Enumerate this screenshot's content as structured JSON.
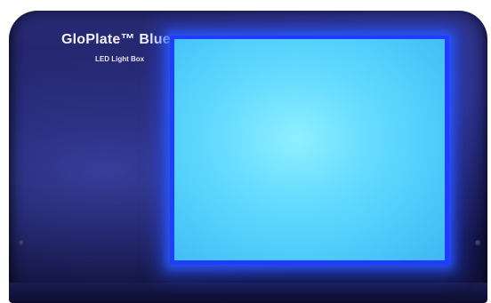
{
  "device": {
    "brand_title": "GloPlate™ Blue",
    "brand_subtitle": "LED Light Box"
  },
  "colors": {
    "body": "#1c1d5e",
    "screen_glow": "#1f3cff",
    "screen_light": "#66dcff"
  }
}
